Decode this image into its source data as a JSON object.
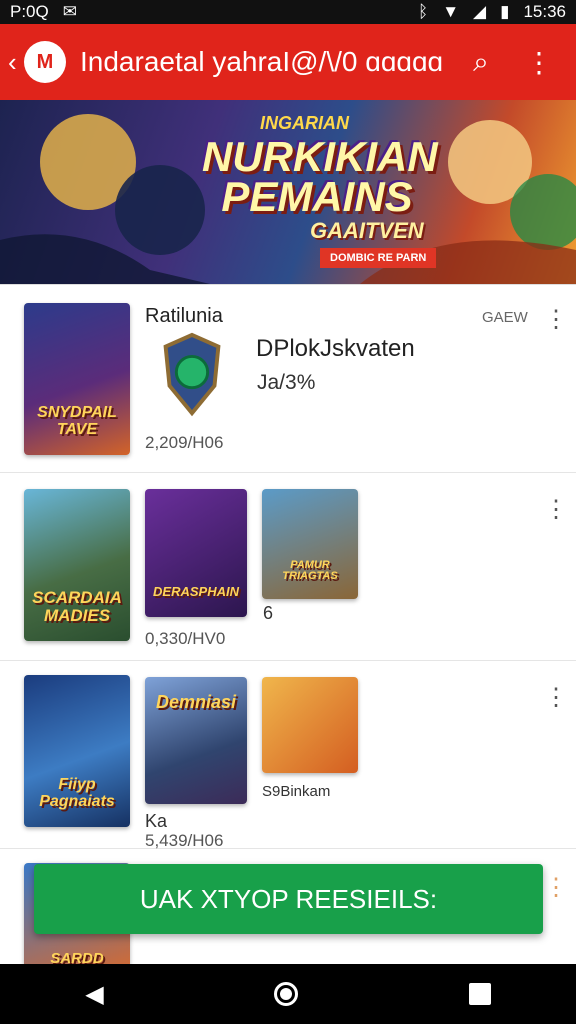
{
  "status_bar": {
    "time_left": "P:0Q",
    "time_right": "15:36",
    "icons": [
      "mail-icon",
      "bluetooth-icon",
      "wifi-icon",
      "signal-icon",
      "battery-icon"
    ]
  },
  "app_bar": {
    "title": "Indaraetal yahraI@/\\/0",
    "title_suffix": "ɑɑɑɑɑ",
    "icons": [
      "back-icon",
      "app-logo-icon",
      "search-icon",
      "more-vert-icon"
    ]
  },
  "banner": {
    "kicker": "INGARIAN",
    "title_line1": "NURKIKIAN",
    "title_line2": "PEMAINS",
    "subtitle": "GAAITVEN",
    "tag": "DOMBIC RE PARN"
  },
  "rows": [
    {
      "title": "Ratilunia",
      "badge": "GAEW",
      "card_caption": "SNYDPAIL TAVE",
      "app_name": "DPlokJskvaten",
      "rating": "Ja/3%",
      "downloads": "2,209/H06"
    },
    {
      "card1_caption": "SCARDAIA MADIES",
      "card2_caption": "DERASPHAIN",
      "card3_caption": "PAMUR TRIAGTAS",
      "count": "6",
      "downloads": "0,330/HV0"
    },
    {
      "card1_caption": "Fiiyp Pagnaiats",
      "card2_caption": "Demniasi",
      "card3_caption": "",
      "name": "S9Binkam",
      "label": "Ka",
      "downloads": "5,439/H06"
    },
    {
      "card_caption": "SARDD"
    }
  ],
  "snackbar": {
    "label": "UAK XTYOP REESIEILS:"
  },
  "colors": {
    "app_bar": "#e0241b",
    "snackbar": "#18a04a",
    "status_bar": "#111111",
    "nav_bar": "#000000"
  }
}
